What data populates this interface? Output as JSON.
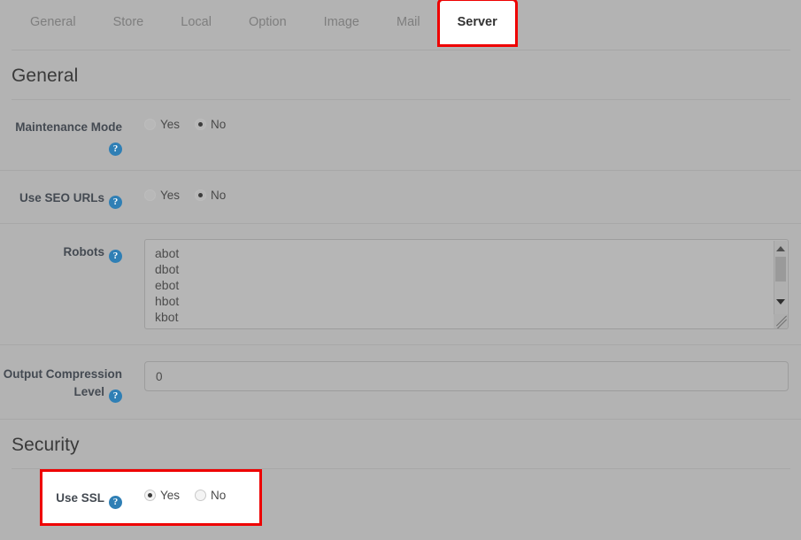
{
  "tabs": [
    {
      "label": "General",
      "active": false
    },
    {
      "label": "Store",
      "active": false
    },
    {
      "label": "Local",
      "active": false
    },
    {
      "label": "Option",
      "active": false
    },
    {
      "label": "Image",
      "active": false
    },
    {
      "label": "Mail",
      "active": false
    },
    {
      "label": "Server",
      "active": true
    }
  ],
  "sections": {
    "general": {
      "heading": "General",
      "maintenance": {
        "label": "Maintenance Mode",
        "help": "?",
        "options": [
          "Yes",
          "No"
        ],
        "selected": "No"
      },
      "seo_urls": {
        "label": "Use SEO URLs",
        "help": "?",
        "options": [
          "Yes",
          "No"
        ],
        "selected": "No"
      },
      "robots": {
        "label": "Robots",
        "help": "?",
        "value": "abot\ndbot\nebot\nhbot\nkbot\nlbot"
      },
      "compression": {
        "label": "Output Compression Level",
        "help": "?",
        "value": "0",
        "placeholder": "Output Compression Level"
      }
    },
    "security": {
      "heading": "Security",
      "use_ssl": {
        "label": "Use SSL",
        "help": "?",
        "options": [
          "Yes",
          "No"
        ],
        "selected": "Yes"
      }
    }
  },
  "annotations": {
    "highlight_color": "#ee0000",
    "targets": [
      "Server",
      "Use SSL"
    ]
  },
  "colors": {
    "page_background": "#b3b3b3",
    "help_icon": "#2f7fb5",
    "heading_text": "#3a3a3a",
    "label_text": "#444a52",
    "annotation": "#ee0000"
  }
}
